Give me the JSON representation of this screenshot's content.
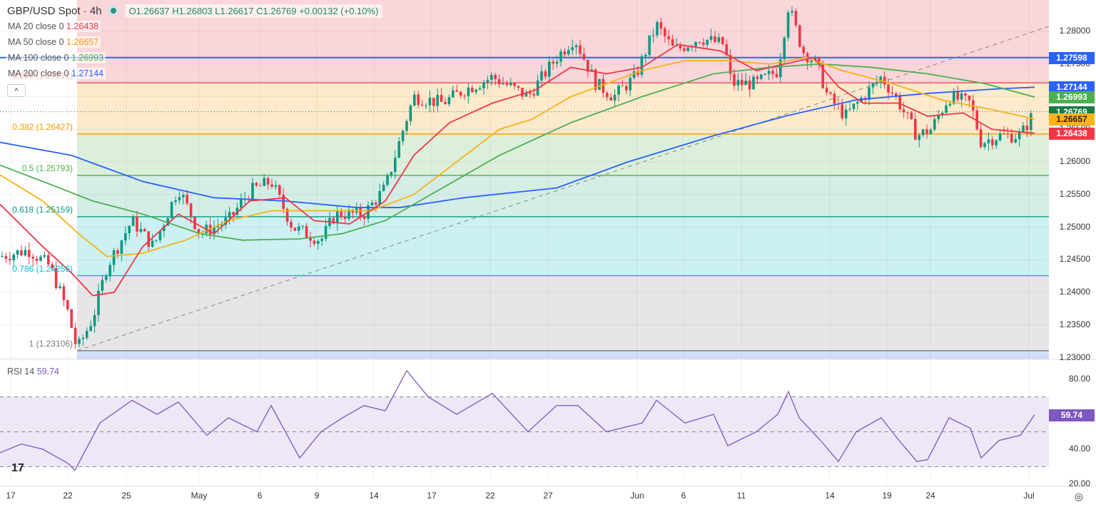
{
  "header": {
    "symbol": "GBP/USD Spot · 4h",
    "ohlc": "O1.26637  H1.26803  L1.26617  C1.26769  +0.00132 (+0.10%)"
  },
  "legend": [
    {
      "label": "MA 20 close 0",
      "value": "1.26438",
      "color": "#f23645"
    },
    {
      "label": "MA 50 close 0",
      "value": "1.26657",
      "color": "#ff9800"
    },
    {
      "label": "MA 100 close 0",
      "value": "1.26993",
      "color": "#4caf50"
    },
    {
      "label": "MA 200 close 0",
      "value": "1.27144",
      "color": "#2962ff"
    }
  ],
  "collapse_label": "^",
  "fib_levels": [
    {
      "label": "0.236 (1.27212)",
      "price": 1.27212,
      "color": "#f23645"
    },
    {
      "label": "0.382 (1.26427)",
      "price": 1.26427,
      "color": "#ff9800"
    },
    {
      "label": "0.5 (1.25793)",
      "price": 1.25793,
      "color": "#4caf50"
    },
    {
      "label": "0.618 (1.25159)",
      "price": 1.25159,
      "color": "#089981"
    },
    {
      "label": "0.786 (1.24256)",
      "price": 1.24256,
      "color": "#00bcd4"
    },
    {
      "label": "1 (1.23106)",
      "price": 1.23106,
      "color": "#787b86"
    }
  ],
  "price_axis": [
    "1.28000",
    "1.27500",
    "1.27000",
    "1.26500",
    "1.26000",
    "1.25500",
    "1.25000",
    "1.24500",
    "1.24000",
    "1.23500",
    "1.23000"
  ],
  "price_tags": [
    {
      "text": "1.27598",
      "price": 1.27598,
      "color": "#2962ff",
      "fg": "#fff"
    },
    {
      "text": "1.27144",
      "price": 1.27144,
      "color": "#2962ff",
      "fg": "#fff"
    },
    {
      "text": "1.26993",
      "price": 1.26993,
      "color": "#4caf50",
      "fg": "#fff"
    },
    {
      "text": "1.26769",
      "price": 1.26769,
      "color": "#1b7a44",
      "fg": "#fff"
    },
    {
      "text": "1.26657",
      "price": 1.26657,
      "color": "#ffb31a",
      "fg": "#222"
    },
    {
      "text": "1.26438",
      "price": 1.26438,
      "color": "#f23645",
      "fg": "#fff"
    }
  ],
  "rsi": {
    "title": "RSI 14",
    "value": "59.74",
    "axis": [
      "80.00",
      "40.00",
      "20.00"
    ]
  },
  "x_axis": [
    {
      "t": "17",
      "x": 15
    },
    {
      "t": "22",
      "x": 95
    },
    {
      "t": "25",
      "x": 177
    },
    {
      "t": "May",
      "x": 279
    },
    {
      "t": "6",
      "x": 364
    },
    {
      "t": "9",
      "x": 444
    },
    {
      "t": "14",
      "x": 524
    },
    {
      "t": "17",
      "x": 605
    },
    {
      "t": "22",
      "x": 687
    },
    {
      "t": "27",
      "x": 768
    },
    {
      "t": "Jun",
      "x": 893
    },
    {
      "t": "6",
      "x": 958
    },
    {
      "t": "11",
      "x": 1039
    },
    {
      "t": "14",
      "x": 1163
    },
    {
      "t": "19",
      "x": 1243
    },
    {
      "t": "24",
      "x": 1304
    },
    {
      "t": "Jul",
      "x": 1442
    }
  ],
  "chart_data": {
    "type": "candlestick",
    "title": "GBP/USD Spot · 4h",
    "ylim": [
      1.23,
      1.285
    ],
    "horizontal_line": 1.27598,
    "price_path": [
      [
        0,
        1.2455
      ],
      [
        40,
        1.2465
      ],
      [
        70,
        1.244
      ],
      [
        95,
        1.237
      ],
      [
        108,
        1.2312
      ],
      [
        130,
        1.236
      ],
      [
        150,
        1.244
      ],
      [
        185,
        1.251
      ],
      [
        215,
        1.247
      ],
      [
        250,
        1.256
      ],
      [
        280,
        1.249
      ],
      [
        320,
        1.251
      ],
      [
        350,
        1.2555
      ],
      [
        380,
        1.257
      ],
      [
        410,
        1.25
      ],
      [
        450,
        1.248
      ],
      [
        470,
        1.252
      ],
      [
        510,
        1.252
      ],
      [
        540,
        1.256
      ],
      [
        565,
        1.265
      ],
      [
        580,
        1.27
      ],
      [
        620,
        1.269
      ],
      [
        650,
        1.271
      ],
      [
        690,
        1.273
      ],
      [
        740,
        1.27
      ],
      [
        780,
        1.276
      ],
      [
        805,
        1.279
      ],
      [
        835,
        1.272
      ],
      [
        860,
        1.27
      ],
      [
        890,
        1.273
      ],
      [
        920,
        1.281
      ],
      [
        945,
        1.277
      ],
      [
        980,
        1.279
      ],
      [
        1015,
        1.278
      ],
      [
        1025,
        1.272
      ],
      [
        1060,
        1.272
      ],
      [
        1090,
        1.274
      ],
      [
        1105,
        1.284
      ],
      [
        1125,
        1.277
      ],
      [
        1145,
        1.275
      ],
      [
        1160,
        1.27
      ],
      [
        1185,
        1.267
      ],
      [
        1210,
        1.27
      ],
      [
        1235,
        1.273
      ],
      [
        1255,
        1.27
      ],
      [
        1285,
        1.264
      ],
      [
        1305,
        1.265
      ],
      [
        1330,
        1.27
      ],
      [
        1360,
        1.269
      ],
      [
        1375,
        1.263
      ],
      [
        1400,
        1.264
      ],
      [
        1430,
        1.264
      ],
      [
        1450,
        1.2677
      ]
    ],
    "ma20": [
      [
        0,
        1.2535
      ],
      [
        60,
        1.247
      ],
      [
        100,
        1.243
      ],
      [
        130,
        1.2395
      ],
      [
        160,
        1.24
      ],
      [
        200,
        1.247
      ],
      [
        250,
        1.252
      ],
      [
        300,
        1.249
      ],
      [
        350,
        1.254
      ],
      [
        400,
        1.2545
      ],
      [
        440,
        1.251
      ],
      [
        490,
        1.2505
      ],
      [
        540,
        1.254
      ],
      [
        580,
        1.261
      ],
      [
        630,
        1.266
      ],
      [
        690,
        1.269
      ],
      [
        750,
        1.271
      ],
      [
        800,
        1.2745
      ],
      [
        850,
        1.2735
      ],
      [
        900,
        1.2745
      ],
      [
        950,
        1.278
      ],
      [
        1010,
        1.277
      ],
      [
        1060,
        1.274
      ],
      [
        1100,
        1.275
      ],
      [
        1140,
        1.276
      ],
      [
        1175,
        1.2715
      ],
      [
        1210,
        1.269
      ],
      [
        1260,
        1.269
      ],
      [
        1300,
        1.267
      ],
      [
        1350,
        1.2675
      ],
      [
        1390,
        1.265
      ],
      [
        1450,
        1.26438
      ]
    ],
    "ma50": [
      [
        0,
        1.258
      ],
      [
        60,
        1.254
      ],
      [
        110,
        1.249
      ],
      [
        150,
        1.2455
      ],
      [
        200,
        1.246
      ],
      [
        260,
        1.248
      ],
      [
        320,
        1.251
      ],
      [
        380,
        1.2525
      ],
      [
        440,
        1.2525
      ],
      [
        520,
        1.2525
      ],
      [
        580,
        1.255
      ],
      [
        640,
        1.26
      ],
      [
        700,
        1.265
      ],
      [
        745,
        1.2665
      ],
      [
        800,
        1.27
      ],
      [
        900,
        1.274
      ],
      [
        960,
        1.2755
      ],
      [
        1020,
        1.2755
      ],
      [
        1080,
        1.275
      ],
      [
        1130,
        1.276
      ],
      [
        1180,
        1.274
      ],
      [
        1250,
        1.272
      ],
      [
        1320,
        1.2695
      ],
      [
        1390,
        1.268
      ],
      [
        1450,
        1.26657
      ]
    ],
    "ma100": [
      [
        0,
        1.2595
      ],
      [
        60,
        1.257
      ],
      [
        130,
        1.254
      ],
      [
        200,
        1.252
      ],
      [
        280,
        1.249
      ],
      [
        340,
        1.248
      ],
      [
        420,
        1.2482
      ],
      [
        480,
        1.249
      ],
      [
        540,
        1.251
      ],
      [
        620,
        1.256
      ],
      [
        700,
        1.261
      ],
      [
        800,
        1.266
      ],
      [
        900,
        1.27
      ],
      [
        1000,
        1.2735
      ],
      [
        1080,
        1.2745
      ],
      [
        1150,
        1.275
      ],
      [
        1220,
        1.2745
      ],
      [
        1300,
        1.2735
      ],
      [
        1380,
        1.272
      ],
      [
        1450,
        1.26993
      ]
    ],
    "ma200": [
      [
        0,
        1.263
      ],
      [
        100,
        1.261
      ],
      [
        200,
        1.257
      ],
      [
        300,
        1.2545
      ],
      [
        400,
        1.254
      ],
      [
        500,
        1.253
      ],
      [
        560,
        1.253
      ],
      [
        650,
        1.2545
      ],
      [
        780,
        1.256
      ],
      [
        880,
        1.26
      ],
      [
        1000,
        1.264
      ],
      [
        1100,
        1.267
      ],
      [
        1200,
        1.2695
      ],
      [
        1300,
        1.2705
      ],
      [
        1400,
        1.2712
      ],
      [
        1450,
        1.27144
      ]
    ],
    "rsi_path": [
      [
        0,
        38
      ],
      [
        30,
        43
      ],
      [
        60,
        40
      ],
      [
        95,
        32
      ],
      [
        105,
        28
      ],
      [
        140,
        55
      ],
      [
        185,
        68
      ],
      [
        220,
        60
      ],
      [
        250,
        67
      ],
      [
        290,
        48
      ],
      [
        320,
        58
      ],
      [
        360,
        50
      ],
      [
        380,
        65
      ],
      [
        420,
        35
      ],
      [
        450,
        50
      ],
      [
        480,
        58
      ],
      [
        510,
        65
      ],
      [
        540,
        62
      ],
      [
        570,
        85
      ],
      [
        600,
        70
      ],
      [
        640,
        60
      ],
      [
        690,
        72
      ],
      [
        740,
        50
      ],
      [
        780,
        65
      ],
      [
        810,
        65
      ],
      [
        850,
        50
      ],
      [
        900,
        55
      ],
      [
        920,
        68
      ],
      [
        960,
        55
      ],
      [
        1000,
        60
      ],
      [
        1020,
        42
      ],
      [
        1060,
        50
      ],
      [
        1090,
        60
      ],
      [
        1105,
        73
      ],
      [
        1120,
        58
      ],
      [
        1150,
        45
      ],
      [
        1175,
        33
      ],
      [
        1200,
        50
      ],
      [
        1235,
        58
      ],
      [
        1260,
        45
      ],
      [
        1285,
        33
      ],
      [
        1300,
        34
      ],
      [
        1330,
        58
      ],
      [
        1360,
        52
      ],
      [
        1375,
        35
      ],
      [
        1400,
        45
      ],
      [
        1430,
        48
      ],
      [
        1450,
        59.74
      ]
    ],
    "rsi_bands": [
      70,
      50,
      30
    ]
  }
}
